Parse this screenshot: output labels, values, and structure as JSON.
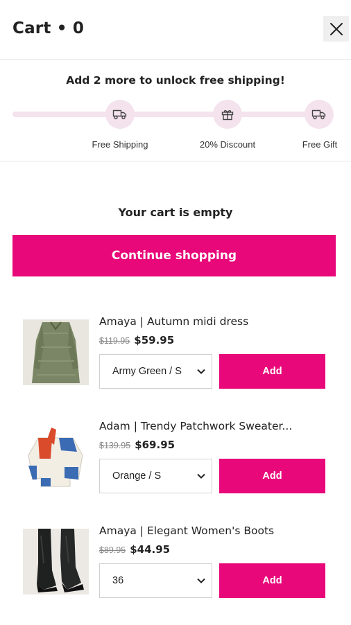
{
  "header": {
    "title": "Cart • 0",
    "close_icon": "close-icon"
  },
  "shipping_progress": {
    "message": "Add 2 more to unlock free shipping!",
    "milestones": [
      {
        "label": "Free Shipping",
        "icon": "truck-icon"
      },
      {
        "label": "20% Discount",
        "icon": "gift-icon"
      },
      {
        "label": "Free Gift",
        "icon": "truck-icon"
      }
    ],
    "colors": {
      "track": "#f4e3ec"
    }
  },
  "cart": {
    "empty_text": "Your cart is empty",
    "continue_label": "Continue shopping"
  },
  "products": [
    {
      "name": "Amaya | Autumn midi dress",
      "old_price": "$119.95",
      "price": "$59.95",
      "variant": "Army Green / S",
      "add_label": "Add"
    },
    {
      "name": "Adam | Trendy Patchwork Sweater...",
      "old_price": "$139.95",
      "price": "$69.95",
      "variant": "Orange / S",
      "add_label": "Add"
    },
    {
      "name": "Amaya | Elegant Women's Boots",
      "old_price": "$89.95",
      "price": "$44.95",
      "variant": "36",
      "add_label": "Add"
    }
  ],
  "colors": {
    "accent": "#e8087a"
  }
}
